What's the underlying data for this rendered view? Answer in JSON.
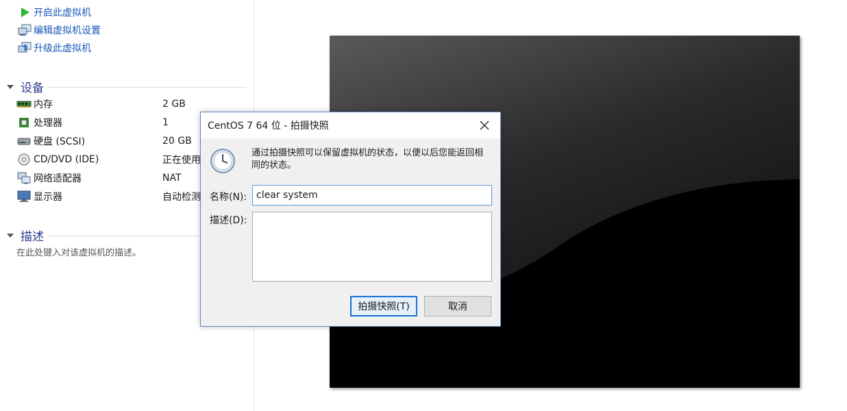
{
  "commands": [
    {
      "label": "开启此虚拟机",
      "icon": "play-icon"
    },
    {
      "label": "编辑虚拟机设置",
      "icon": "edit-settings-icon"
    },
    {
      "label": "升级此虚拟机",
      "icon": "upgrade-icon"
    }
  ],
  "devices_section": {
    "title": "设备",
    "items": [
      {
        "name": "内存",
        "value": "2 GB",
        "icon": "memory-icon"
      },
      {
        "name": "处理器",
        "value": "1",
        "icon": "processor-icon"
      },
      {
        "name": "硬盘 (SCSI)",
        "value": "20 GB",
        "icon": "hard-disk-icon"
      },
      {
        "name": "CD/DVD (IDE)",
        "value": "正在使用",
        "icon": "cd-dvd-icon"
      },
      {
        "name": "网络适配器",
        "value": "NAT",
        "icon": "network-adapter-icon"
      },
      {
        "name": "显示器",
        "value": "自动检测",
        "icon": "display-icon"
      }
    ]
  },
  "description_section": {
    "title": "描述",
    "hint": "在此处键入对该虚拟机的描述。"
  },
  "dialog": {
    "title": "CentOS 7 64 位 - 拍摄快照",
    "info": "通过拍摄快照可以保留虚拟机的状态，以便以后您能返回相同的状态。",
    "name_label": "名称(N):",
    "name_value": "clear system",
    "desc_label": "描述(D):",
    "desc_value": "",
    "snapshot_button": "拍摄快照(T)",
    "cancel_button": "取消"
  },
  "colors": {
    "link": "#1a56b8",
    "section_title": "#2b3a8c",
    "dialog_border": "#5a86c6",
    "focus_blue": "#1a6fd1"
  }
}
